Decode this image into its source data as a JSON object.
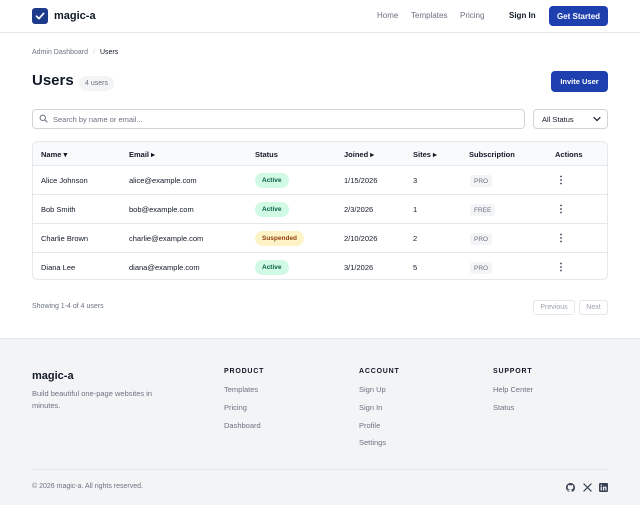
{
  "header": {
    "brand": "magic-a",
    "nav": [
      "Home",
      "Templates",
      "Pricing"
    ],
    "sign_in": "Sign In",
    "cta": "Get Started"
  },
  "breadcrumb": {
    "parent": "Admin Dashboard",
    "separator": "/",
    "current": "Users"
  },
  "page": {
    "title": "Users",
    "count": "4 users",
    "invite_button": "Invite User"
  },
  "filters": {
    "search_placeholder": "Search by name or email...",
    "search_value": "",
    "status_selected": "All Status"
  },
  "table": {
    "columns": {
      "name": "Name ▾",
      "email": "Email ▸",
      "status": "Status",
      "joined": "Joined ▸",
      "sites": "Sites ▸",
      "subscription": "Subscription",
      "actions": "Actions"
    },
    "rows": [
      {
        "name": "Alice Johnson",
        "email": "alice@example.com",
        "status": "Active",
        "joined": "1/15/2026",
        "sites": "3",
        "plan": "PRO"
      },
      {
        "name": "Bob Smith",
        "email": "bob@example.com",
        "status": "Active",
        "joined": "2/3/2026",
        "sites": "1",
        "plan": "FREE"
      },
      {
        "name": "Charlie Brown",
        "email": "charlie@example.com",
        "status": "Suspended",
        "joined": "2/10/2026",
        "sites": "2",
        "plan": "PRO"
      },
      {
        "name": "Diana Lee",
        "email": "diana@example.com",
        "status": "Active",
        "joined": "3/1/2026",
        "sites": "5",
        "plan": "PRO"
      }
    ]
  },
  "pagination": {
    "summary": "Showing 1-4 of 4 users",
    "previous": "Previous",
    "next": "Next"
  },
  "footer": {
    "brand": "magic-a",
    "tagline": "Build beautiful one-page websites in minutes.",
    "columns": [
      {
        "heading": "PRODUCT",
        "links": [
          "Templates",
          "Pricing",
          "Dashboard"
        ]
      },
      {
        "heading": "ACCOUNT",
        "links": [
          "Sign Up",
          "Sign In",
          "Profile",
          "Settings"
        ]
      },
      {
        "heading": "SUPPORT",
        "links": [
          "Help Center",
          "Status"
        ]
      }
    ],
    "copyright": "© 2026 magic-a. All rights reserved.",
    "social": [
      "github-icon",
      "x-icon",
      "linkedin-icon"
    ]
  },
  "colors": {
    "primary": "#1e40af",
    "active_bg": "#d1fae5",
    "active_text": "#065f46",
    "suspended_bg": "#fef3c7",
    "suspended_text": "#92400e"
  }
}
